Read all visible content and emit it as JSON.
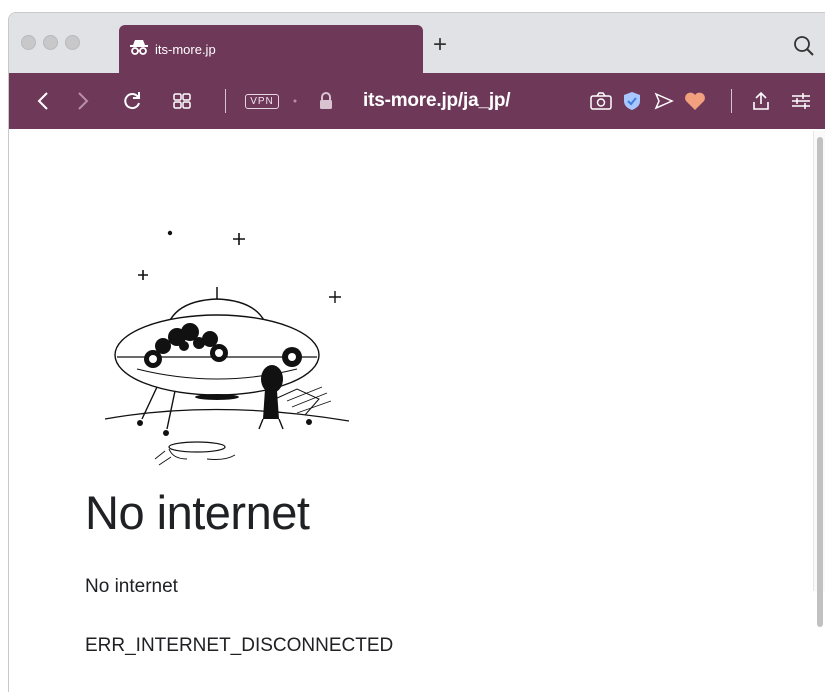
{
  "browser": {
    "tab": {
      "title": "its-more.jp",
      "icon": "incognito-icon"
    },
    "new_tab_label": "+",
    "toolbar": {
      "vpn_label": "VPN",
      "url": "its-more.jp/ja_jp/"
    },
    "accent_color": "#6e3859"
  },
  "page": {
    "title": "No internet",
    "subtitle": "No internet",
    "error_code": "ERR_INTERNET_DISCONNECTED"
  }
}
